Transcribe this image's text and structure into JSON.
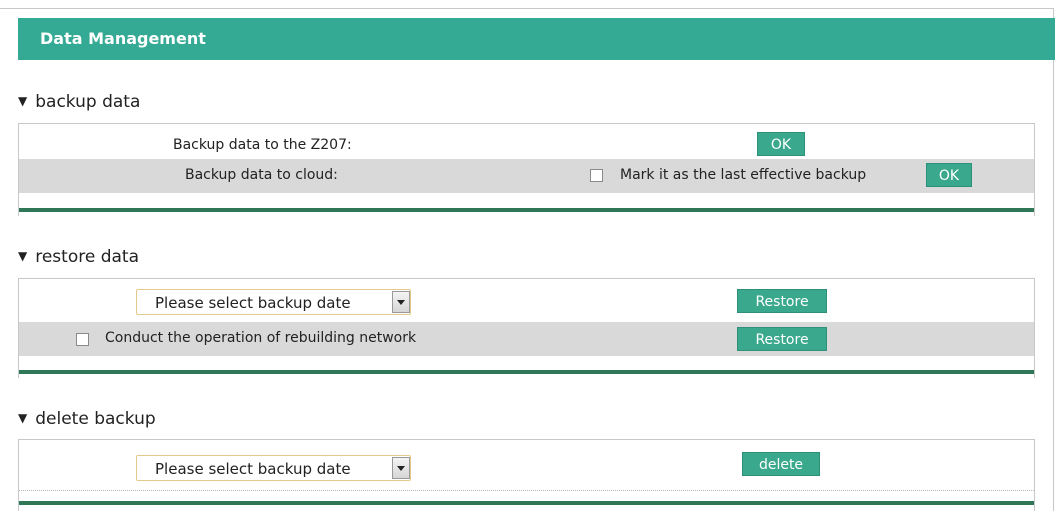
{
  "page": {
    "title": "Data Management"
  },
  "sections": {
    "backup": {
      "title": "backup data",
      "row1": {
        "label": "Backup data to the Z207:",
        "button": "OK"
      },
      "row2": {
        "label": "Backup data to cloud:",
        "checkbox_label": "Mark it as the last effective backup",
        "checkbox_checked": false,
        "button": "OK"
      }
    },
    "restore": {
      "title": "restore data",
      "row1": {
        "select_value": "Please select backup date",
        "button": "Restore"
      },
      "row2": {
        "checkbox_label": "Conduct the operation of rebuilding network",
        "checkbox_checked": false,
        "button": "Restore"
      }
    },
    "delete": {
      "title": "delete backup",
      "row1": {
        "select_value": "Please select backup date",
        "button": "delete"
      }
    }
  },
  "colors": {
    "header": "#34a993",
    "button": "#3aa88d",
    "panel_bar": "#2f7757",
    "grey_row": "#d9d9d9"
  }
}
